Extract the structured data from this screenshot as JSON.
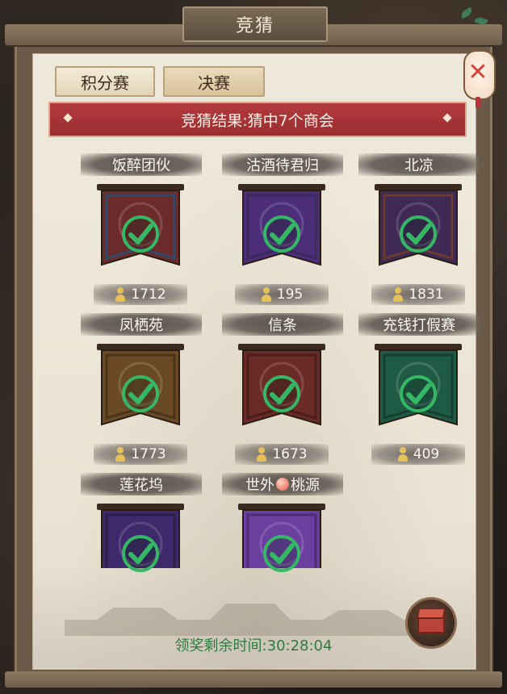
{
  "header": {
    "title": "竞猜"
  },
  "tabs": [
    {
      "label": "积分赛"
    },
    {
      "label": "决赛"
    }
  ],
  "result_text": "竞猜结果:猜中7个商会",
  "guilds": [
    {
      "name": "饭醉团伙",
      "score": "1712",
      "banner_color": "#6b2b2b",
      "accent": "#2e4a6a"
    },
    {
      "name": "沽酒待君归",
      "score": "195",
      "banner_color": "#4c2e78",
      "accent": "#3a2a5c"
    },
    {
      "name": "北凉",
      "score": "1831",
      "banner_color": "#3e2a55",
      "accent": "#6b3a2e"
    },
    {
      "name": "凤栖苑",
      "score": "1773",
      "banner_color": "#6a4a25",
      "accent": "#4a341b"
    },
    {
      "name": "信条",
      "score": "1673",
      "banner_color": "#6a2a26",
      "accent": "#4b1e1b"
    },
    {
      "name": "充钱打假赛",
      "score": "409",
      "banner_color": "#1f5a45",
      "accent": "#163f31"
    },
    {
      "name": "莲花坞",
      "score": "",
      "banner_color": "#3e2a6a",
      "accent": "#2c1f4b"
    },
    {
      "name_left": "世外",
      "name_right": "桃源",
      "score": "",
      "banner_color": "#6a3fa0",
      "accent": "#4c2d74"
    }
  ],
  "timer_text": "领奖剩余时间:30:28:04",
  "colors": {
    "check_green": "#35b866",
    "result_red": "#a83437",
    "timer_green": "#2f7a3f"
  }
}
